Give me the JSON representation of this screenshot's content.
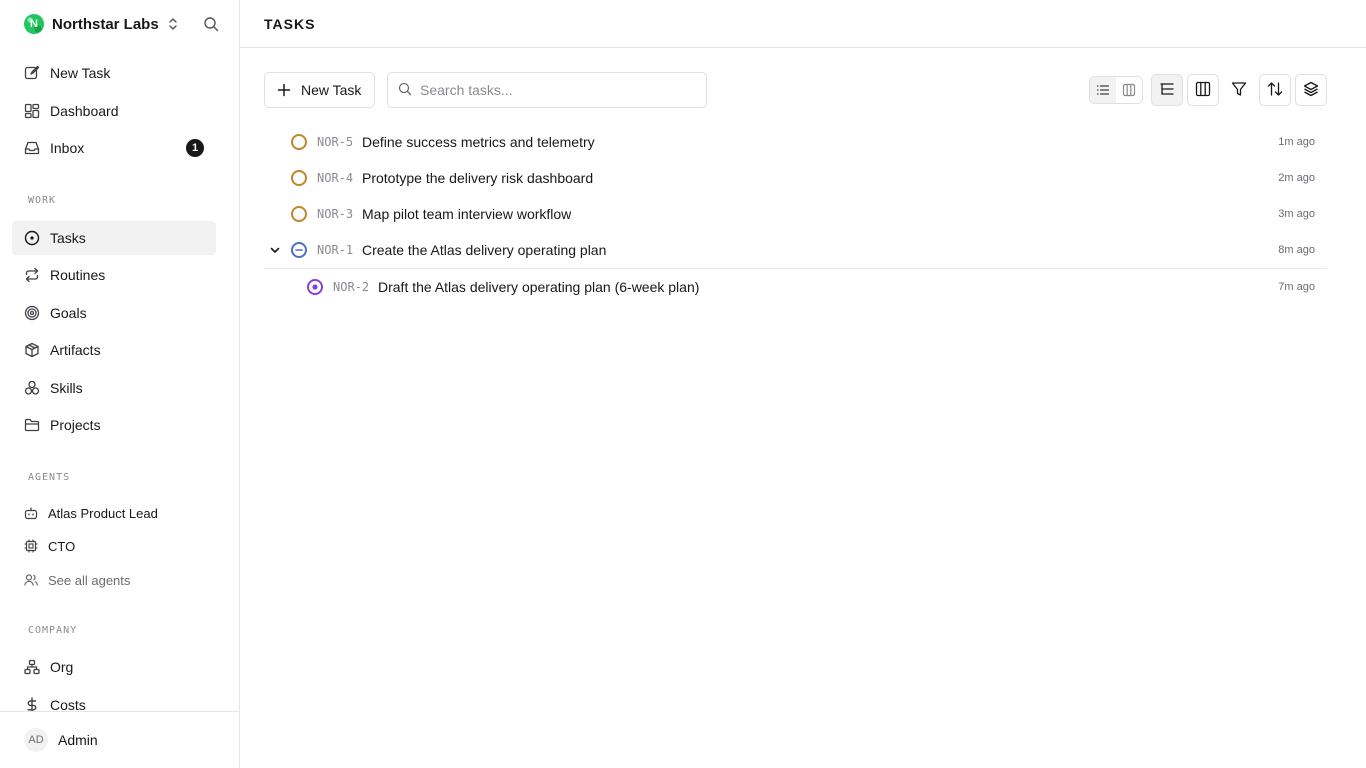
{
  "workspace": {
    "name": "Northstar Labs",
    "logo_letter": "N"
  },
  "nav": {
    "new_task": "New Task",
    "dashboard": "Dashboard",
    "inbox": "Inbox",
    "inbox_count": "1"
  },
  "sections": {
    "work": "WORK",
    "agents": "AGENTS",
    "company": "COMPANY"
  },
  "work_items": [
    {
      "label": "Tasks",
      "icon": "circle-dot-icon",
      "active": true
    },
    {
      "label": "Routines",
      "icon": "repeat-icon"
    },
    {
      "label": "Goals",
      "icon": "target-icon"
    },
    {
      "label": "Artifacts",
      "icon": "package-icon"
    },
    {
      "label": "Skills",
      "icon": "boxes-icon"
    },
    {
      "label": "Projects",
      "icon": "folder-icon"
    }
  ],
  "agents": [
    {
      "label": "Atlas Product Lead",
      "icon": "bot-icon"
    },
    {
      "label": "CTO",
      "icon": "cpu-icon"
    }
  ],
  "see_all_agents": "See all agents",
  "company_items": [
    {
      "label": "Org",
      "icon": "network-icon"
    },
    {
      "label": "Costs",
      "icon": "dollar-icon"
    }
  ],
  "user": {
    "initials": "AD",
    "name": "Admin"
  },
  "page": {
    "title": "TASKS"
  },
  "toolbar": {
    "new_task_label": "New Task",
    "search_placeholder": "Search tasks..."
  },
  "tasks": [
    {
      "id": "NOR-5",
      "title": "Define success metrics and telemetry",
      "time": "1m ago",
      "status": "todo"
    },
    {
      "id": "NOR-4",
      "title": "Prototype the delivery risk dashboard",
      "time": "2m ago",
      "status": "todo"
    },
    {
      "id": "NOR-3",
      "title": "Map pilot team interview workflow",
      "time": "3m ago",
      "status": "todo"
    },
    {
      "id": "NOR-1",
      "title": "Create the Atlas delivery operating plan",
      "time": "8m ago",
      "status": "blocked",
      "expanded": true
    },
    {
      "id": "NOR-2",
      "title": "Draft the Atlas delivery operating plan (6-week plan)",
      "time": "7m ago",
      "status": "in-progress",
      "child": true
    }
  ],
  "colors": {
    "todo": "#c0842b",
    "blocked": "#4f6fc4",
    "in_progress": "#8b3fd1",
    "brand": "#22c55e"
  }
}
